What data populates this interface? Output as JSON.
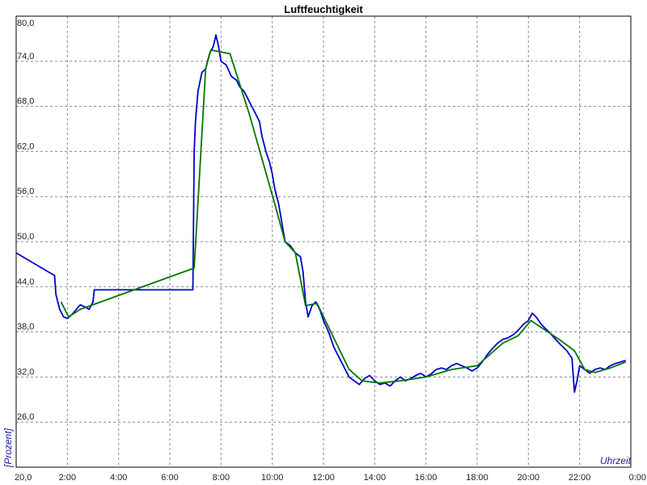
{
  "chart_data": {
    "type": "line",
    "title": "Luftfeuchtigkeit",
    "xlabel": "Uhrzeit",
    "ylabel": "[Prozent]",
    "xlim": [
      0,
      24
    ],
    "ylim": [
      20,
      80
    ],
    "grid": true,
    "x_ticks": [
      {
        "value": 0,
        "label": "20,0"
      },
      {
        "value": 2,
        "label": "2:00"
      },
      {
        "value": 4,
        "label": "4:00"
      },
      {
        "value": 6,
        "label": "6:00"
      },
      {
        "value": 8,
        "label": "8:00"
      },
      {
        "value": 10,
        "label": "10:00"
      },
      {
        "value": 12,
        "label": "12:00"
      },
      {
        "value": 14,
        "label": "14:00"
      },
      {
        "value": 16,
        "label": "16:00"
      },
      {
        "value": 18,
        "label": "18:00"
      },
      {
        "value": 20,
        "label": "20:00"
      },
      {
        "value": 22,
        "label": "22:00"
      },
      {
        "value": 24,
        "label": "0:00"
      }
    ],
    "y_ticks": [
      {
        "value": 26,
        "label": "26,0"
      },
      {
        "value": 32,
        "label": "32,0"
      },
      {
        "value": 38,
        "label": "38,0"
      },
      {
        "value": 44,
        "label": "44,0"
      },
      {
        "value": 50,
        "label": "50,0"
      },
      {
        "value": 56,
        "label": "56,0"
      },
      {
        "value": 62,
        "label": "62,0"
      },
      {
        "value": 68,
        "label": "68,0"
      },
      {
        "value": 74,
        "label": "74,0"
      },
      {
        "value": 80,
        "label": "80,0"
      }
    ],
    "series": [
      {
        "color": "#0000cc",
        "points": [
          [
            0.0,
            48.5
          ],
          [
            1.5,
            45.5
          ],
          [
            1.55,
            43.0
          ],
          [
            1.7,
            41.0
          ],
          [
            1.85,
            40.0
          ],
          [
            2.0,
            39.8
          ],
          [
            2.15,
            40.2
          ],
          [
            2.3,
            40.8
          ],
          [
            2.5,
            41.6
          ],
          [
            2.7,
            41.3
          ],
          [
            2.85,
            41.0
          ],
          [
            3.0,
            42.0
          ],
          [
            3.05,
            43.6
          ],
          [
            3.5,
            43.6
          ],
          [
            5.0,
            43.6
          ],
          [
            6.9,
            43.6
          ],
          [
            6.95,
            62.0
          ],
          [
            7.0,
            66.0
          ],
          [
            7.1,
            70.0
          ],
          [
            7.25,
            72.5
          ],
          [
            7.4,
            73.0
          ],
          [
            7.55,
            75.0
          ],
          [
            7.7,
            76.0
          ],
          [
            7.8,
            77.5
          ],
          [
            7.9,
            76.0
          ],
          [
            8.0,
            74.0
          ],
          [
            8.2,
            73.5
          ],
          [
            8.4,
            72.0
          ],
          [
            8.6,
            71.5
          ],
          [
            8.75,
            70.5
          ],
          [
            8.9,
            70.0
          ],
          [
            9.05,
            69.0
          ],
          [
            9.2,
            68.0
          ],
          [
            9.35,
            67.0
          ],
          [
            9.5,
            66.0
          ],
          [
            9.6,
            64.0
          ],
          [
            9.75,
            62.0
          ],
          [
            9.9,
            60.5
          ],
          [
            10.0,
            59.0
          ],
          [
            10.1,
            57.0
          ],
          [
            10.25,
            55.0
          ],
          [
            10.4,
            52.0
          ],
          [
            10.5,
            50.0
          ],
          [
            10.7,
            49.5
          ],
          [
            10.9,
            48.5
          ],
          [
            11.1,
            48.0
          ],
          [
            11.2,
            46.0
          ],
          [
            11.3,
            42.0
          ],
          [
            11.4,
            40.0
          ],
          [
            11.55,
            41.5
          ],
          [
            11.7,
            42.0
          ],
          [
            11.85,
            41.0
          ],
          [
            12.0,
            39.5
          ],
          [
            12.2,
            38.0
          ],
          [
            12.4,
            36.0
          ],
          [
            12.55,
            35.0
          ],
          [
            12.7,
            34.0
          ],
          [
            12.85,
            33.0
          ],
          [
            13.0,
            32.0
          ],
          [
            13.2,
            31.5
          ],
          [
            13.4,
            31.0
          ],
          [
            13.6,
            31.8
          ],
          [
            13.8,
            32.2
          ],
          [
            14.0,
            31.5
          ],
          [
            14.2,
            31.0
          ],
          [
            14.4,
            31.2
          ],
          [
            14.6,
            30.8
          ],
          [
            14.8,
            31.5
          ],
          [
            15.0,
            32.0
          ],
          [
            15.2,
            31.5
          ],
          [
            15.4,
            31.8
          ],
          [
            15.6,
            32.2
          ],
          [
            15.8,
            32.5
          ],
          [
            16.0,
            32.0
          ],
          [
            16.2,
            32.4
          ],
          [
            16.4,
            33.0
          ],
          [
            16.6,
            33.2
          ],
          [
            16.8,
            33.0
          ],
          [
            17.0,
            33.5
          ],
          [
            17.2,
            33.8
          ],
          [
            17.4,
            33.5
          ],
          [
            17.6,
            33.2
          ],
          [
            17.8,
            32.8
          ],
          [
            18.0,
            33.2
          ],
          [
            18.2,
            34.0
          ],
          [
            18.4,
            35.0
          ],
          [
            18.6,
            35.8
          ],
          [
            18.8,
            36.5
          ],
          [
            19.0,
            37.0
          ],
          [
            19.2,
            37.2
          ],
          [
            19.4,
            37.6
          ],
          [
            19.6,
            38.2
          ],
          [
            19.8,
            39.0
          ],
          [
            20.0,
            39.5
          ],
          [
            20.15,
            40.5
          ],
          [
            20.3,
            40.0
          ],
          [
            20.5,
            39.0
          ],
          [
            20.8,
            38.0
          ],
          [
            21.2,
            36.5
          ],
          [
            21.5,
            35.5
          ],
          [
            21.7,
            34.5
          ],
          [
            21.8,
            30.0
          ],
          [
            21.9,
            31.5
          ],
          [
            22.0,
            33.5
          ],
          [
            22.2,
            33.0
          ],
          [
            22.4,
            32.5
          ],
          [
            22.6,
            33.0
          ],
          [
            22.8,
            33.2
          ],
          [
            23.0,
            33.0
          ],
          [
            23.2,
            33.5
          ],
          [
            23.4,
            33.8
          ],
          [
            23.6,
            34.0
          ],
          [
            23.8,
            34.2
          ]
        ]
      },
      {
        "color": "#007700",
        "points": [
          [
            1.75,
            42.0
          ],
          [
            2.05,
            40.0
          ],
          [
            2.5,
            41.0
          ],
          [
            6.95,
            46.5
          ],
          [
            7.4,
            73.0
          ],
          [
            7.6,
            75.5
          ],
          [
            8.35,
            75.0
          ],
          [
            9.1,
            67.0
          ],
          [
            10.1,
            55.0
          ],
          [
            10.5,
            50.0
          ],
          [
            10.9,
            48.5
          ],
          [
            11.3,
            41.5
          ],
          [
            11.75,
            41.8
          ],
          [
            12.5,
            36.5
          ],
          [
            13.0,
            33.0
          ],
          [
            13.5,
            31.5
          ],
          [
            14.2,
            31.2
          ],
          [
            15.0,
            31.5
          ],
          [
            16.0,
            32.0
          ],
          [
            17.0,
            33.0
          ],
          [
            18.0,
            33.5
          ],
          [
            19.0,
            36.5
          ],
          [
            19.6,
            37.5
          ],
          [
            20.1,
            39.5
          ],
          [
            21.2,
            37.0
          ],
          [
            21.8,
            35.5
          ],
          [
            22.2,
            33.0
          ],
          [
            22.6,
            32.6
          ],
          [
            23.2,
            33.2
          ],
          [
            23.8,
            34.0
          ]
        ]
      }
    ]
  }
}
